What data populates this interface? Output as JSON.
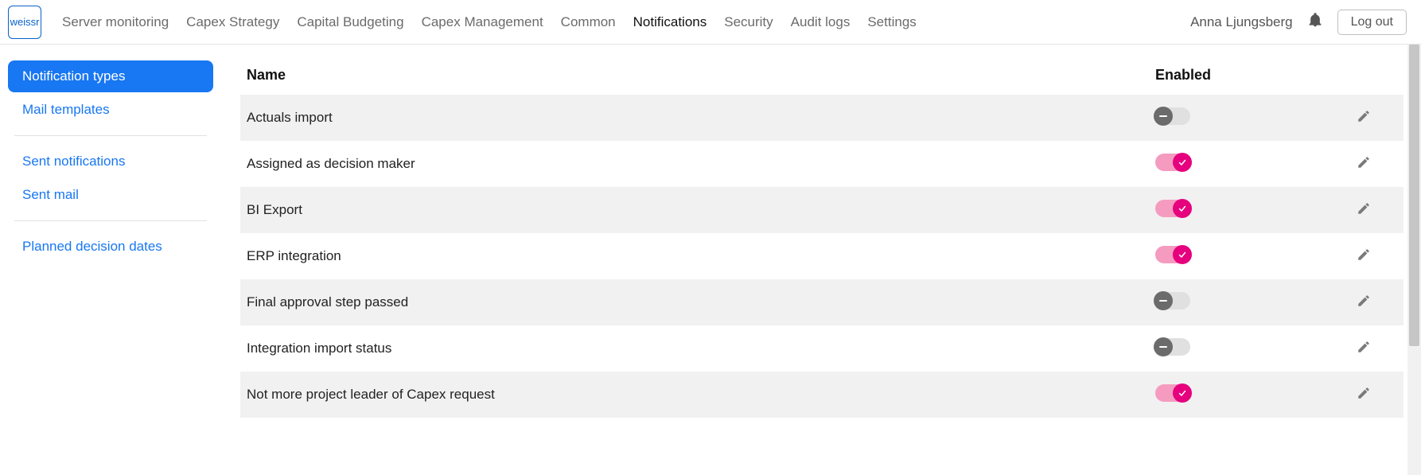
{
  "logo_text": "weissr",
  "nav": {
    "items": [
      {
        "label": "Server monitoring",
        "active": false
      },
      {
        "label": "Capex Strategy",
        "active": false
      },
      {
        "label": "Capital Budgeting",
        "active": false
      },
      {
        "label": "Capex Management",
        "active": false
      },
      {
        "label": "Common",
        "active": false
      },
      {
        "label": "Notifications",
        "active": true
      },
      {
        "label": "Security",
        "active": false
      },
      {
        "label": "Audit logs",
        "active": false
      },
      {
        "label": "Settings",
        "active": false
      }
    ]
  },
  "user": {
    "name": "Anna Ljungsberg"
  },
  "logout_label": "Log out",
  "sidebar": {
    "groups": [
      [
        {
          "label": "Notification types",
          "active": true
        },
        {
          "label": "Mail templates",
          "active": false
        }
      ],
      [
        {
          "label": "Sent notifications",
          "active": false
        },
        {
          "label": "Sent mail",
          "active": false
        }
      ],
      [
        {
          "label": "Planned decision dates",
          "active": false
        }
      ]
    ]
  },
  "table": {
    "headers": {
      "name": "Name",
      "enabled": "Enabled"
    },
    "rows": [
      {
        "name": "Actuals import",
        "enabled": false
      },
      {
        "name": "Assigned as decision maker",
        "enabled": true
      },
      {
        "name": "BI Export",
        "enabled": true
      },
      {
        "name": "ERP integration",
        "enabled": true
      },
      {
        "name": "Final approval step passed",
        "enabled": false
      },
      {
        "name": "Integration import status",
        "enabled": false
      },
      {
        "name": "Not more project leader of Capex request",
        "enabled": true
      }
    ]
  }
}
